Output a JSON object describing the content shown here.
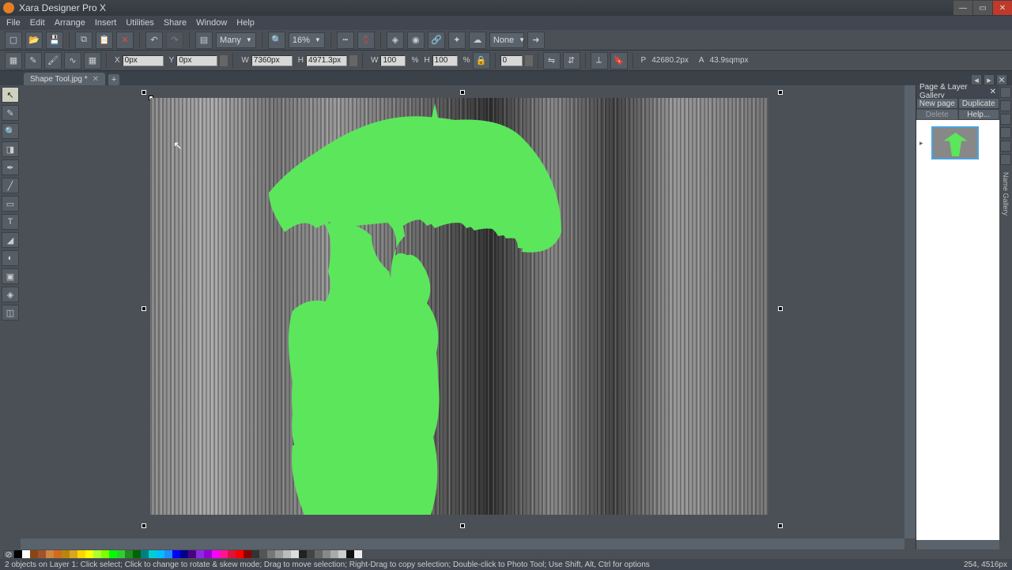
{
  "app": {
    "title": "Xara Designer Pro X"
  },
  "menu": [
    "File",
    "Edit",
    "Arrange",
    "Insert",
    "Utilities",
    "Share",
    "Window",
    "Help"
  ],
  "toolbar1": {
    "select_label": "Many",
    "zoom_label": "16%",
    "prop_label": "None"
  },
  "toolbar2": {
    "x_label": "X",
    "x_value": "0px",
    "y_label": "Y",
    "y_value": "0px",
    "w_label": "W",
    "w_value": "7360px",
    "h_label": "H",
    "h_value": "4971.3px",
    "wp_value": "100",
    "hp_value": "100",
    "angle_value": "0",
    "p_label": "P",
    "p_value": "42680.2px",
    "a_label": "A",
    "a_value": "43.9sqmpx"
  },
  "tab": {
    "name": "Shape Tool.jpg *"
  },
  "panel": {
    "title": "Page & Layer Gallery",
    "newpage": "New page",
    "duplicate": "Duplicate",
    "delete": "Delete",
    "help": "Help..."
  },
  "right_label": "Name Gallery",
  "status": {
    "left": "2 objects on Layer 1: Click select; Click to change to rotate & skew mode; Drag to move selection; Right-Drag to copy selection; Double-click to Photo Tool; Use Shift, Alt, Ctrl for options",
    "right": "254, 4516px"
  },
  "colors": [
    "#000",
    "#fff",
    "#8b4513",
    "#a0522d",
    "#cd853f",
    "#d2691e",
    "#b8860b",
    "#daa520",
    "#ffd700",
    "#ffff00",
    "#adff2f",
    "#7fff00",
    "#00ff00",
    "#32cd32",
    "#228b22",
    "#006400",
    "#008080",
    "#00ced1",
    "#00bfff",
    "#1e90ff",
    "#0000ff",
    "#00008b",
    "#4b0082",
    "#8a2be2",
    "#9400d3",
    "#ff00ff",
    "#ff1493",
    "#dc143c",
    "#ff0000",
    "#8b0000",
    "#333",
    "#555",
    "#777",
    "#999",
    "#bbb",
    "#ddd",
    "#222",
    "#444",
    "#666",
    "#888",
    "#aaa",
    "#ccc",
    "#111",
    "#eee"
  ]
}
